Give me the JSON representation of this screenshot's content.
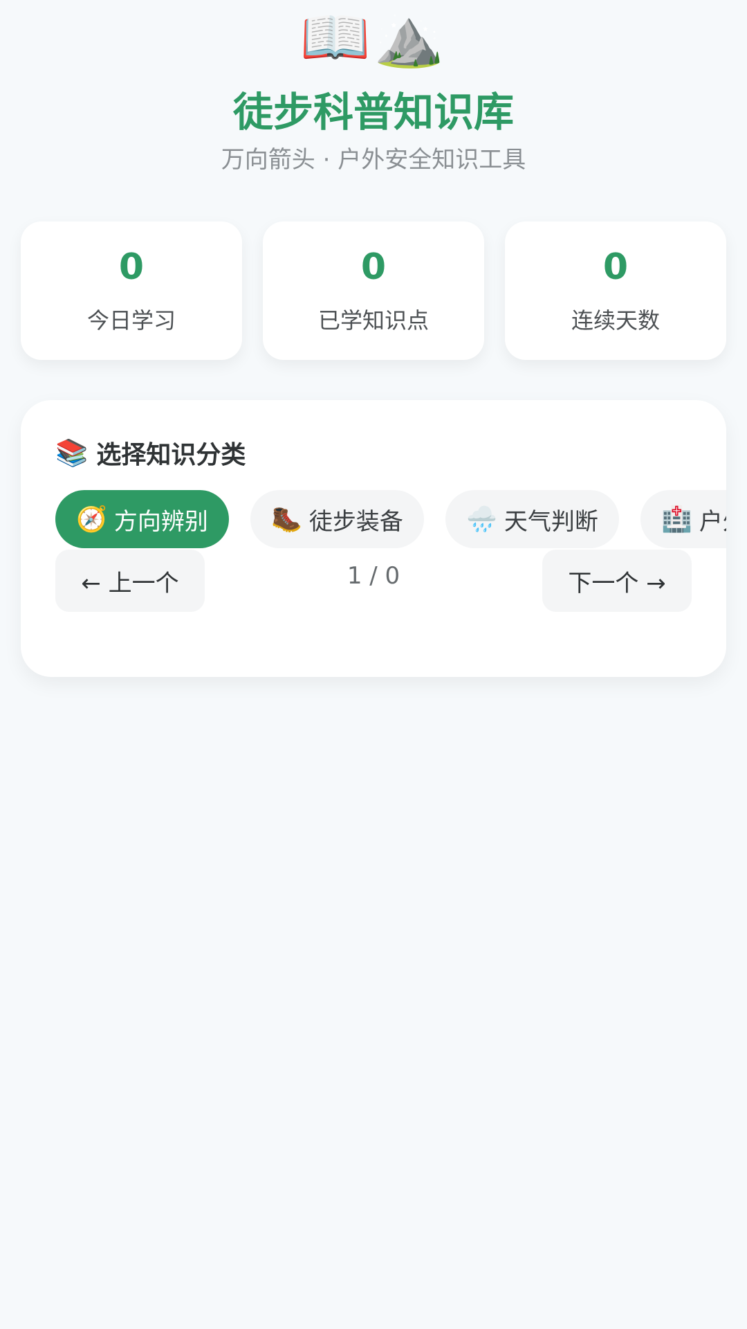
{
  "header": {
    "icons": [
      "open-book-icon",
      "mountain-icon"
    ],
    "hero_glyphs": "📖⛰️",
    "title": "徒步科普知识库",
    "subtitle": "万向箭头 · 户外安全知识工具"
  },
  "stats": [
    {
      "value": "0",
      "label": "今日学习"
    },
    {
      "value": "0",
      "label": "已学知识点"
    },
    {
      "value": "0",
      "label": "连续天数"
    }
  ],
  "category_panel": {
    "title_icon": "📚",
    "title": "选择知识分类",
    "chips": [
      {
        "icon": "🧭",
        "label": "方向辨别",
        "active": true
      },
      {
        "icon": "🥾",
        "label": "徒步装备",
        "active": false
      },
      {
        "icon": "🌧️",
        "label": "天气判断",
        "active": false
      },
      {
        "icon": "🏥",
        "label": "户外",
        "active": false
      }
    ],
    "prev_label": "← 上一个",
    "next_label": "下一个 →",
    "pager": "1 / 0"
  },
  "colors": {
    "accent": "#2e9a64",
    "background": "#f6f9fb",
    "card": "#ffffff",
    "chip_bg": "#f4f5f6"
  }
}
